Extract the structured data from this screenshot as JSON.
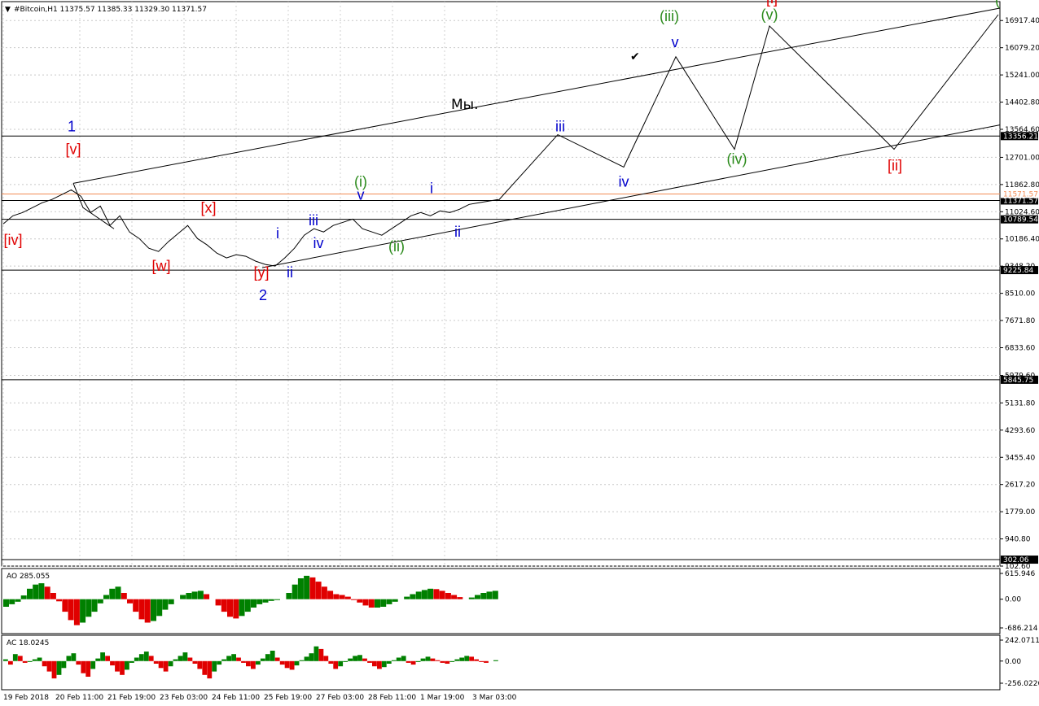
{
  "chart_data": [
    {
      "type": "line",
      "header": "#Bitcoin,H1  11375.57 11385.33 11329.30 11371.57",
      "x_ticks": [
        "19 Feb 2018",
        "20 Feb 11:00",
        "21 Feb 19:00",
        "23 Feb 03:00",
        "24 Feb 11:00",
        "25 Feb 19:00",
        "27 Feb 03:00",
        "28 Feb 11:00",
        "1 Mar 19:00",
        "3 Mar 03:00"
      ],
      "y_ticks": [
        "16917.40",
        "16079.20",
        "15241.00",
        "14402.80",
        "13564.60",
        "12701.00",
        "11862.80",
        "11024.60",
        "10186.40",
        "9348.20",
        "8510.00",
        "7671.80",
        "6833.60",
        "5979.60",
        "5131.80",
        "4293.60",
        "3455.40",
        "2617.20",
        "1779.00",
        "940.80",
        "102.60"
      ],
      "ylim": [
        102.6,
        17500
      ],
      "grid": true,
      "price": [
        10650,
        10900,
        11000,
        11150,
        11300,
        11400,
        11550,
        11700,
        11500,
        11000,
        11200,
        10600,
        10900,
        10400,
        10200,
        9900,
        9800,
        10100,
        10350,
        10600,
        10200,
        10000,
        9750,
        9600,
        9700,
        9650,
        9500,
        9400,
        9350,
        9600,
        9900,
        10300,
        10500,
        10400,
        10600,
        10700,
        10800,
        10500,
        10400,
        10300,
        10500,
        10700,
        10900,
        11000,
        10900,
        11050,
        11000,
        11100,
        11250,
        11300,
        11350,
        11400
      ],
      "price_levels": [
        {
          "value": 11371.57,
          "label": "11371.57",
          "style": "current",
          "color": "#000000"
        },
        {
          "value": 11571.57,
          "label": "11571.57",
          "style": "ask",
          "color": "#f28b54"
        },
        {
          "value": 10789.54,
          "label": "10789.54",
          "style": "hline",
          "color": "#000000"
        },
        {
          "value": 13356.21,
          "label": "13356.21",
          "style": "hline",
          "color": "#000000"
        },
        {
          "value": 9225.84,
          "label": "9225.84",
          "style": "hline",
          "color": "#000000"
        },
        {
          "value": 5845.75,
          "label": "5845.75",
          "style": "hline",
          "color": "#000000"
        },
        {
          "value": 302.06,
          "label": "302.06",
          "style": "hline",
          "color": "#000000"
        }
      ],
      "projection": [
        [
          11371,
          11371
        ],
        [
          13400,
          13400
        ],
        [
          12400,
          12400
        ],
        [
          15800,
          15800
        ],
        [
          12950,
          12950
        ],
        [
          16750,
          16750
        ],
        [
          12950,
          12950
        ],
        [
          17100,
          17100
        ]
      ],
      "channel_text": "Мы.",
      "check_mark": "✔",
      "wave_labels": [
        {
          "text": "1",
          "color": "#0000cc",
          "value": 13500
        },
        {
          "text": "[v]",
          "color": "#e00000",
          "value": 12800
        },
        {
          "text": "[iv]",
          "color": "#e00000",
          "value": 10000
        },
        {
          "text": "[w]",
          "color": "#e00000",
          "value": 9200
        },
        {
          "text": "[x]",
          "color": "#e00000",
          "value": 11000
        },
        {
          "text": "[y]",
          "color": "#e00000",
          "value": 9000
        },
        {
          "text": "2",
          "color": "#0000cc",
          "value": 8300
        },
        {
          "text": "i",
          "color": "#0000cc",
          "value": 10200
        },
        {
          "text": "ii",
          "color": "#0000cc",
          "value": 9000
        },
        {
          "text": "iii",
          "color": "#0000cc",
          "value": 10600
        },
        {
          "text": "iv",
          "color": "#0000cc",
          "value": 9900
        },
        {
          "text": "(i)",
          "color": "#2a8a1a",
          "value": 11800
        },
        {
          "text": "v",
          "color": "#0000cc",
          "value": 11400
        },
        {
          "text": "(ii)",
          "color": "#2a8a1a",
          "value": 9800
        },
        {
          "text": "i",
          "color": "#0000cc",
          "value": 11600
        },
        {
          "text": "ii",
          "color": "#0000cc",
          "value": 10250
        },
        {
          "text": "iii",
          "color": "#0000cc",
          "value": 13500
        },
        {
          "text": "iv",
          "color": "#0000cc",
          "value": 11800
        },
        {
          "text": "(iii)",
          "color": "#2a8a1a",
          "value": 16900
        },
        {
          "text": "v",
          "color": "#0000cc",
          "value": 16100
        },
        {
          "text": "(iv)",
          "color": "#2a8a1a",
          "value": 12500
        },
        {
          "text": "(v)",
          "color": "#2a8a1a",
          "value": 16950
        },
        {
          "text": "[i]",
          "color": "#e00000",
          "value": 17450
        },
        {
          "text": "[ii]",
          "color": "#e00000",
          "value": 12300
        },
        {
          "text": "(",
          "color": "#2a8a1a",
          "value": 17400
        }
      ]
    },
    {
      "type": "bar",
      "indicator": "AO",
      "label": "AO 285.055",
      "y_ticks": [
        "615.946",
        "0.00",
        "-686.214"
      ],
      "ylim": [
        -686.214,
        615.946
      ],
      "values": [
        -180,
        -120,
        -60,
        90,
        250,
        350,
        380,
        300,
        150,
        -50,
        -300,
        -500,
        -620,
        -560,
        -420,
        -300,
        -100,
        100,
        250,
        300,
        150,
        -100,
        -300,
        -480,
        -560,
        -520,
        -400,
        -250,
        -120,
        0,
        100,
        150,
        180,
        200,
        120,
        0,
        -150,
        -300,
        -420,
        -460,
        -400,
        -300,
        -200,
        -120,
        -80,
        -40,
        -20,
        0,
        150,
        350,
        500,
        560,
        520,
        420,
        300,
        200,
        120,
        100,
        60,
        -20,
        -80,
        -150,
        -200,
        -200,
        -180,
        -120,
        -60,
        0,
        60,
        120,
        180,
        220,
        250,
        240,
        200,
        150,
        100,
        50,
        0,
        40,
        100,
        150,
        180,
        200
      ]
    },
    {
      "type": "bar",
      "indicator": "AC",
      "label": "AC 18.0245",
      "y_ticks": [
        "242.0711",
        "0.00",
        "-256.0226"
      ],
      "ylim": [
        -256.0226,
        242.0711
      ],
      "values": [
        20,
        -40,
        80,
        60,
        -20,
        -10,
        20,
        40,
        -60,
        -120,
        -200,
        -160,
        -80,
        60,
        90,
        -40,
        -140,
        -180,
        -90,
        30,
        100,
        60,
        -50,
        -120,
        -160,
        -100,
        -20,
        40,
        80,
        110,
        60,
        -30,
        -80,
        -120,
        -60,
        20,
        60,
        100,
        40,
        -30,
        -90,
        -160,
        -200,
        -120,
        -40,
        20,
        60,
        80,
        40,
        -20,
        -60,
        -90,
        -40,
        30,
        80,
        120,
        40,
        -40,
        -80,
        -100,
        -50,
        10,
        50,
        90,
        170,
        140,
        60,
        -30,
        -90,
        -60,
        -10,
        30,
        60,
        70,
        30,
        -20,
        -60,
        -90,
        -70,
        -30,
        10,
        40,
        60,
        -20,
        -40,
        -10,
        30,
        50,
        30,
        10,
        -20,
        -30,
        -10,
        20,
        40,
        60,
        50,
        20,
        -10,
        -20,
        0,
        10
      ]
    }
  ]
}
